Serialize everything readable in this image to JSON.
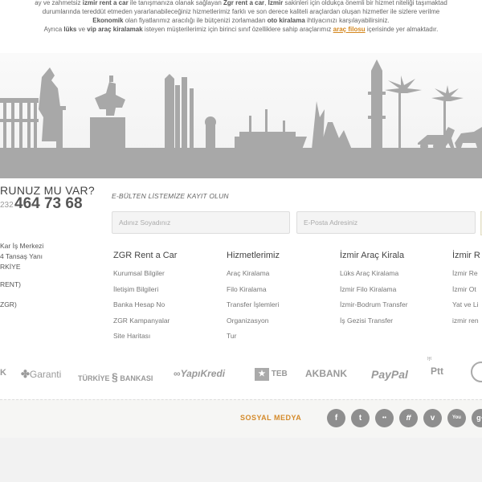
{
  "intro": {
    "line1_parts": [
      "ay ve zahmetsiz ",
      "izmir rent a car",
      " ile tanışmanıza olanak sağlayan ",
      "Zgr rent a car",
      ", ",
      "İzmir",
      " sakinleri için oldukça önemli bir hizmet niteliği taşımaktad"
    ],
    "line2": "durumlarında tereddüt etmeden yararlanabileceğiniz hizmetlerimiz farklı ve son derece kaliteli araçlardan oluşan hizmetler ile sizlere verilme",
    "line3_parts": [
      "Ekonomik",
      " olan fiyatlarımız aracılığı ile bütçenizi zorlamadan ",
      "oto kiralama",
      " ihtiyacınızı karşılayabilirsiniz."
    ],
    "line4_parts": [
      "Ayrıca ",
      "lüks",
      " ve ",
      "vip araç kiralamak",
      " isteyen müşterilerimiz için birinci sınıf özelliklere sahip araçlarımız ",
      "araç filosu",
      " içerisinde yer almaktadır."
    ]
  },
  "contact": {
    "question": "RUNUZ MU VAR?",
    "phone_prefix": "232",
    "phone": "464 73 68",
    "address_lines": [
      "Kar İş Merkezi",
      "4 Tansaş Yanı",
      "RKİYE"
    ],
    "misc1": "RENT)",
    "misc2": "ZGR)"
  },
  "newsletter": {
    "title": "E-BÜLTEN LİSTEMİZE KAYIT OLUN",
    "name_placeholder": "Adınız Soyadınız",
    "email_placeholder": "E-Posta Adresiniz"
  },
  "columns": [
    {
      "title": "ZGR Rent a Car",
      "links": [
        "Kurumsal Bilgiler",
        "İletişim Bilgileri",
        "Banka Hesap No",
        "ZGR Kampanyalar",
        "Site Haritası"
      ]
    },
    {
      "title": "Hizmetlerimiz",
      "links": [
        "Araç Kiralama",
        "Filo Kiralama",
        "Transfer İşlemleri",
        "Organizasyon",
        "Tur"
      ]
    },
    {
      "title": "İzmir Araç Kirala",
      "links": [
        "Lüks Araç Kiralama",
        "İzmir Filo Kiralama",
        "İzmir-Bodrum Transfer",
        "İş Gezisi Transfer"
      ]
    },
    {
      "title": "İzmir R",
      "links": [
        "İzmir Re",
        "İzmir Ot",
        "Yat ve Li",
        "izmir ren"
      ]
    }
  ],
  "banks": [
    "K",
    "Garanti",
    "TÜRKİYE",
    "BANKASI",
    "YapıKredi",
    "TEB",
    "AKBANK",
    "PayPal",
    "Ptt"
  ],
  "social": {
    "label": "SOSYAL MEDYA",
    "icons": [
      "facebook-icon",
      "twitter-icon",
      "flickr-icon",
      "friendfeed-icon",
      "vimeo-icon",
      "youtube-icon",
      "google-plus-icon"
    ],
    "glyphs": [
      "f",
      "t",
      "••",
      "ff",
      "v",
      "You",
      "g+"
    ]
  },
  "colors": {
    "accent": "#d4871e",
    "skyline": "#a6a6a6"
  }
}
